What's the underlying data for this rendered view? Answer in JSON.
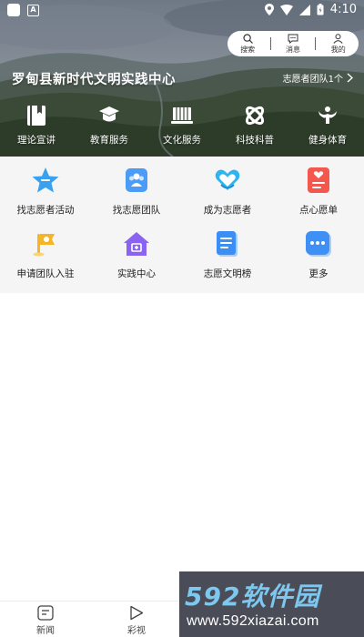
{
  "statusbar": {
    "time": "4:10"
  },
  "topmenu": {
    "items": [
      {
        "label": "搜索",
        "icon": "search-icon"
      },
      {
        "label": "消息",
        "icon": "message-icon"
      },
      {
        "label": "我的",
        "icon": "user-icon"
      }
    ]
  },
  "hero": {
    "title": "罗甸县新时代文明实践中心",
    "team_link": "志愿者团队1个"
  },
  "categories": [
    {
      "label": "理论宣讲",
      "icon": "book-icon"
    },
    {
      "label": "教育服务",
      "icon": "graduation-cap-icon"
    },
    {
      "label": "文化服务",
      "icon": "culture-icon"
    },
    {
      "label": "科技科普",
      "icon": "atom-icon"
    },
    {
      "label": "健身体育",
      "icon": "fitness-icon"
    }
  ],
  "functions": [
    {
      "label": "找志愿者活动",
      "icon": "star-icon",
      "color": "#3aa0f0"
    },
    {
      "label": "找志愿团队",
      "icon": "team-icon",
      "color": "#4a9cf6"
    },
    {
      "label": "成为志愿者",
      "icon": "heart-hands-icon",
      "color": "#2fb4f2"
    },
    {
      "label": "点心愿单",
      "icon": "wish-list-icon",
      "color": "#f4574e"
    },
    {
      "label": "申请团队入驻",
      "icon": "flag-icon",
      "color": "#f5b526"
    },
    {
      "label": "实践中心",
      "icon": "home-center-icon",
      "color": "#8a63f0"
    },
    {
      "label": "志愿文明榜",
      "icon": "document-icon",
      "color": "#3b8ef3"
    },
    {
      "label": "更多",
      "icon": "more-icon",
      "color": "#3f8ff5"
    }
  ],
  "bottomnav": [
    {
      "label": "新闻",
      "icon": "news-icon"
    },
    {
      "label": "彩视",
      "icon": "play-icon"
    }
  ],
  "watermark": {
    "brand": "592软件园",
    "url": "www.592xiazai.com"
  }
}
